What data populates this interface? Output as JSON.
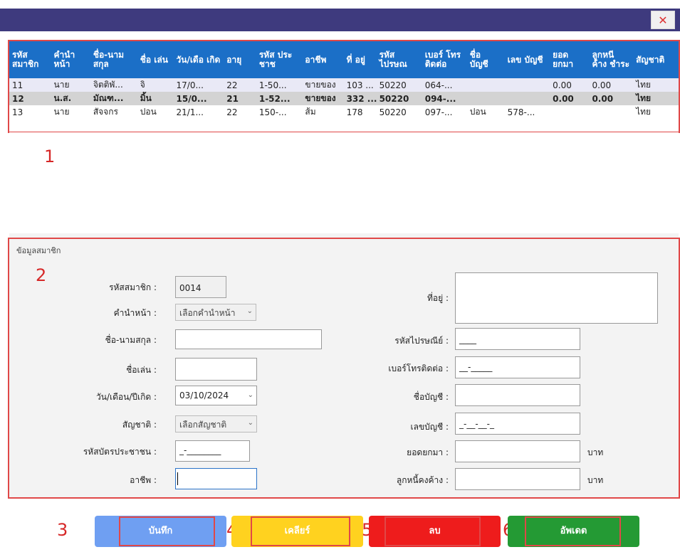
{
  "window": {
    "close_glyph": "✕"
  },
  "grid": {
    "columns": [
      "รหัส สมาชิก",
      "คำนำ หน้า",
      "ชื่อ-นาม สกุล",
      "ชื่อ เล่น",
      "วัน/เดือ เกิด",
      "อายุ",
      "รหัส ประชาช",
      "อาชีพ",
      "ที่ อยู่",
      "รหัส ไปรษณ",
      "เบอร์ โทร ติดต่อ",
      "ชื่อ บัญชี",
      "เลข บัญชี",
      "ยอด ยกมา",
      "ลูกหนี ค้าง ชำระ",
      "สัญชาติ"
    ],
    "rows": [
      [
        "11",
        "นาย",
        "จิตติพั...",
        "จิ",
        "17/0...",
        "22",
        "1-50...",
        "ขายของ",
        "103 ...",
        "50220",
        "064-...",
        "",
        "",
        "0.00",
        "0.00",
        "ไทย"
      ],
      [
        "12",
        "น.ส.",
        "มัณฑ...",
        "มิ้น",
        "15/0...",
        "21",
        "1-52...",
        "ขายของ",
        "332 ...",
        "50220",
        "094-...",
        "",
        "",
        "0.00",
        "0.00",
        "ไทย"
      ],
      [
        "13",
        "นาย",
        "สัจจกร",
        "ปอน",
        "21/1...",
        "22",
        "150-...",
        "ส้ม",
        "178",
        "50220",
        "097-...",
        "ปอน",
        "578-...",
        "",
        "",
        "ไทย"
      ]
    ]
  },
  "annotations": {
    "a1": "1",
    "a2": "2",
    "a3": "3",
    "a4": "4",
    "a5": "5",
    "a6": "6"
  },
  "form": {
    "group_title": "ข้อมูลสมาชิก",
    "member_id_label": "รหัสสมาชิก :",
    "member_id_value": "0014",
    "prefix_label": "คำนำหน้า :",
    "prefix_value": "เลือกคำนำหน้า",
    "fullname_label": "ชื่อ-นามสกุล :",
    "nickname_label": "ชื่อเล่น :",
    "birthdate_label": "วัน/เดือน/ปีเกิด :",
    "birthdate_value": "03/10/2024",
    "nationality_label": "สัญชาติ :",
    "nationality_value": "เลือกสัญชาติ",
    "citizen_id_label": "รหัสบัตรประชาชน :",
    "citizen_id_mask": "_-________",
    "occupation_label": "อาชีพ :",
    "address_label": "ที่อยู่ :",
    "postal_label": "รหัสไปรษณีย์ :",
    "postal_mask": "____",
    "phone_label": "เบอร์โทรติดต่อ :",
    "phone_mask": "__-_____",
    "account_name_label": "ชื่อบัญชี :",
    "account_no_label": "เลขบัญชี :",
    "account_no_mask": "_-__-__-_",
    "balance_label": "ยอดยกมา :",
    "debt_label": "ลูกหนี้คงค้าง :",
    "unit_baht": "บาท",
    "chevron": "⌄"
  },
  "buttons": {
    "save": "บันทึก",
    "clear": "เคลียร์",
    "delete": "ลบ",
    "update": "อัพเดต"
  },
  "colors": {
    "titlebar": "#3e3a7e",
    "header": "#1b6fc7",
    "save": "#6f9ff2",
    "clear": "#ffd21f",
    "delete": "#ee1c1c",
    "update": "#249a34",
    "annotation": "#e04848"
  }
}
